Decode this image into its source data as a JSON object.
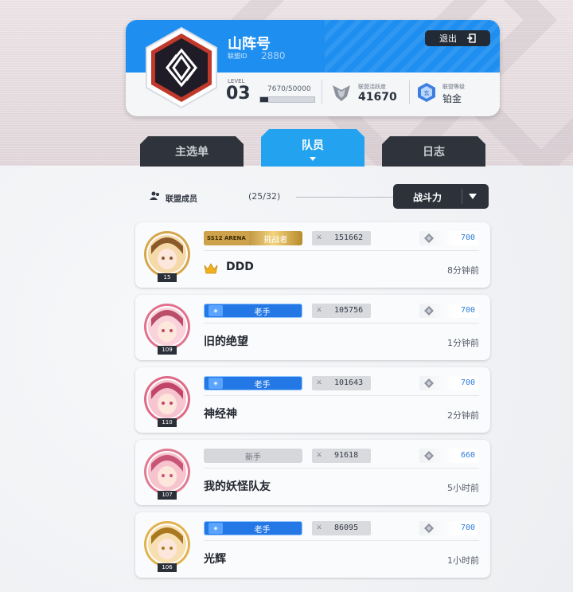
{
  "guild": {
    "name": "山阵号",
    "id_label": "联盟ID",
    "id": "2880",
    "logout": "退出",
    "level_label": "LEVEL",
    "level": "03",
    "exp_text": "7670/50000",
    "exp_progress": 0.153,
    "activity_label": "联盟活跃度",
    "activity_value": "41670",
    "rank_label": "联盟等级",
    "rank_value": "铂金"
  },
  "tabs": [
    {
      "label": "主选单",
      "active": false
    },
    {
      "label": "队员",
      "active": true
    },
    {
      "label": "日志",
      "active": false
    }
  ],
  "member_header": {
    "label": "联盟成员",
    "count": "(25/32)",
    "sort_value": "战斗力"
  },
  "colors": {
    "brand_blue": "#1e8ff0",
    "tab_active": "#23a3ef",
    "dark": "#2f343c",
    "veteran_badge": "#2478e6"
  },
  "members": [
    {
      "badge_type": "challenger",
      "badge_prefix": "SS12 ARENA",
      "badge": "挑战者",
      "power": "151662",
      "stamina": "700",
      "name": "DDD",
      "leader": true,
      "time": "8分钟前",
      "level": "15"
    },
    {
      "badge_type": "veteran",
      "badge": "老手",
      "power": "105756",
      "stamina": "700",
      "name": "旧的绝望",
      "leader": false,
      "time": "1分钟前",
      "level": "109"
    },
    {
      "badge_type": "veteran",
      "badge": "老手",
      "power": "101643",
      "stamina": "700",
      "name": "神经神",
      "leader": false,
      "time": "2分钟前",
      "level": "110"
    },
    {
      "badge_type": "novice",
      "badge": "新手",
      "power": "91618",
      "stamina": "660",
      "name": "我的妖怪队友",
      "leader": false,
      "time": "5小时前",
      "level": "107"
    },
    {
      "badge_type": "veteran",
      "badge": "老手",
      "power": "86095",
      "stamina": "700",
      "name": "光辉",
      "leader": false,
      "time": "1小时前",
      "level": "106"
    }
  ]
}
